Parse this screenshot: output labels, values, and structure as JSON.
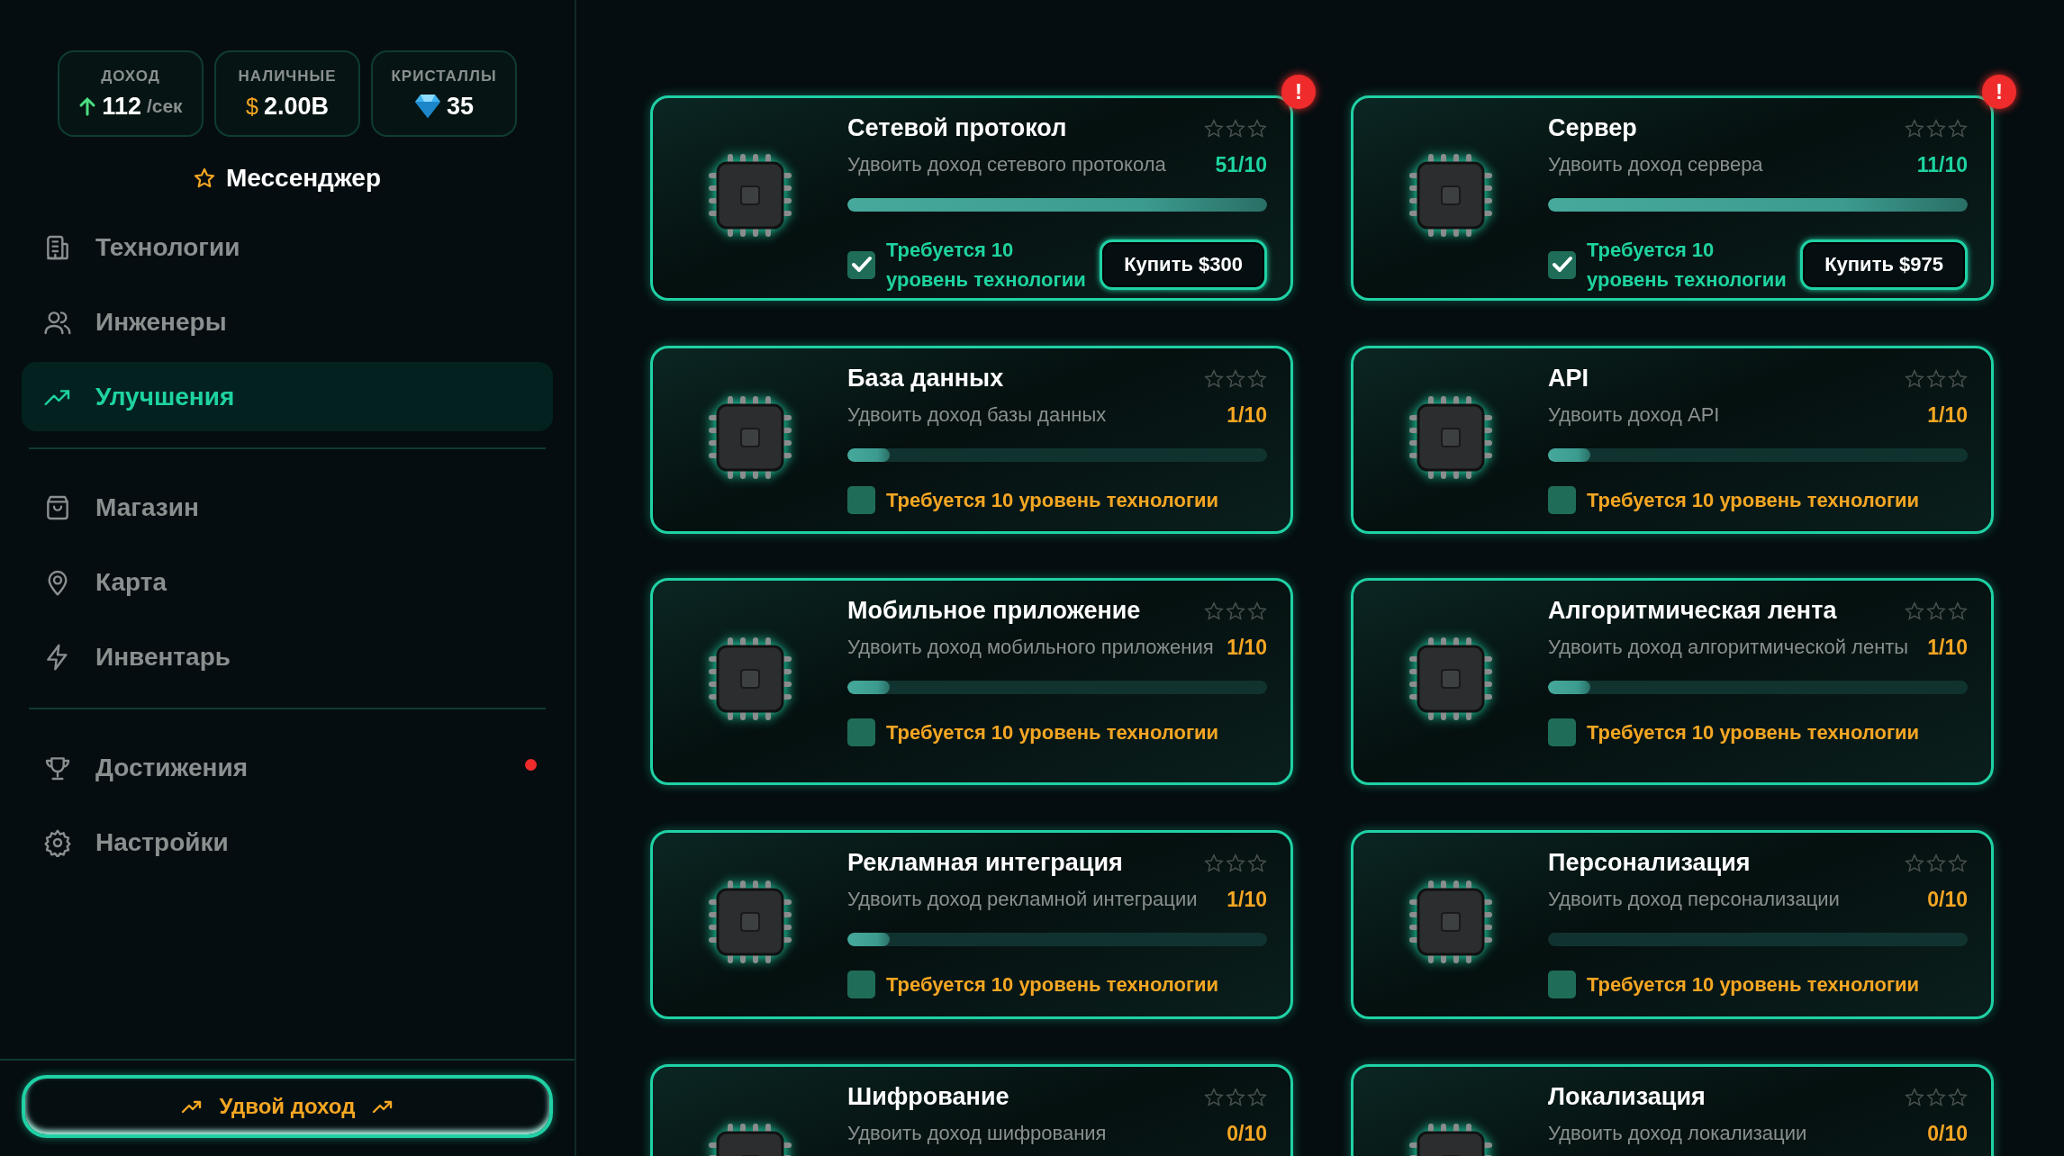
{
  "stats": [
    {
      "label": "ДОХОД",
      "value": "112",
      "unit": "/сек",
      "kind": "income"
    },
    {
      "label": "НАЛИЧНЫЕ",
      "value": "2.00B",
      "prefix": "$",
      "kind": "cash"
    },
    {
      "label": "КРИСТАЛЛЫ",
      "value": "35",
      "kind": "crystals"
    }
  ],
  "company": "Мессенджер",
  "nav_groups": [
    {
      "items": [
        {
          "label": "Технологии",
          "selected": false,
          "alert": false
        },
        {
          "label": "Инженеры",
          "selected": false,
          "alert": false
        },
        {
          "label": "Улучшения",
          "selected": true,
          "alert": false
        }
      ]
    },
    {
      "items": [
        {
          "label": "Магазин",
          "selected": false,
          "alert": false
        },
        {
          "label": "Карта",
          "selected": false,
          "alert": false
        },
        {
          "label": "Инвентарь",
          "selected": false,
          "alert": false
        }
      ]
    },
    {
      "items": [
        {
          "label": "Достижения",
          "selected": false,
          "alert": true
        },
        {
          "label": "Настройки",
          "selected": false,
          "alert": false
        }
      ]
    }
  ],
  "boost_button": "Удвой доход",
  "upgrades": [
    {
      "title": "Сетевой протокол",
      "stars": 0,
      "description": "Удвоить доход сетевого протокола",
      "count": "51/10",
      "level": 1,
      "requirement": {
        "text": "Требуется 10 уровень технологии",
        "met": true
      },
      "button": "Купить $300",
      "badge": "!"
    },
    {
      "title": "Сервер",
      "stars": 0,
      "description": "Удвоить доход сервера",
      "count": "11/10",
      "level": 1,
      "requirement": {
        "text": "Требуется 10 уровень технологии",
        "met": true
      },
      "button": "Купить $975",
      "badge": "!"
    },
    {
      "title": "База данных",
      "stars": 0,
      "description": "Удвоить доход базы данных",
      "count": "1/10",
      "level": 0.1,
      "requirement": {
        "text": "Требуется 10 уровень технологии",
        "met": false
      }
    },
    {
      "title": "API",
      "stars": 0,
      "description": "Удвоить доход API",
      "count": "1/10",
      "level": 0.1,
      "requirement": {
        "text": "Требуется 10 уровень технологии",
        "met": false
      }
    },
    {
      "title": "Мобильное приложение",
      "stars": 0,
      "description": "Удвоить доход мобильного приложения",
      "count": "1/10",
      "level": 0.1,
      "requirement": {
        "text": "Требуется 10 уровень технологии",
        "met": false
      }
    },
    {
      "title": "Алгоритмическая лента",
      "stars": 0,
      "description": "Удвоить доход алгоритмической ленты",
      "count": "1/10",
      "level": 0.1,
      "requirement": {
        "text": "Требуется 10 уровень технологии",
        "met": false
      }
    },
    {
      "title": "Рекламная интеграция",
      "stars": 0,
      "description": "Удвоить доход рекламной интеграции",
      "count": "1/10",
      "level": 0.1,
      "requirement": {
        "text": "Требуется 10 уровень технологии",
        "met": false
      }
    },
    {
      "title": "Персонализация",
      "stars": 0,
      "description": "Удвоить доход персонализации",
      "count": "0/10",
      "level": 0,
      "requirement": {
        "text": "Требуется 10 уровень технологии",
        "met": false
      }
    },
    {
      "title": "Шифрование",
      "stars": 0,
      "description": "Удвоить доход шифрования",
      "count": "0/10"
    },
    {
      "title": "Локализация",
      "stars": 0,
      "description": "Удвоить доход локализации",
      "count": "0/10"
    }
  ]
}
